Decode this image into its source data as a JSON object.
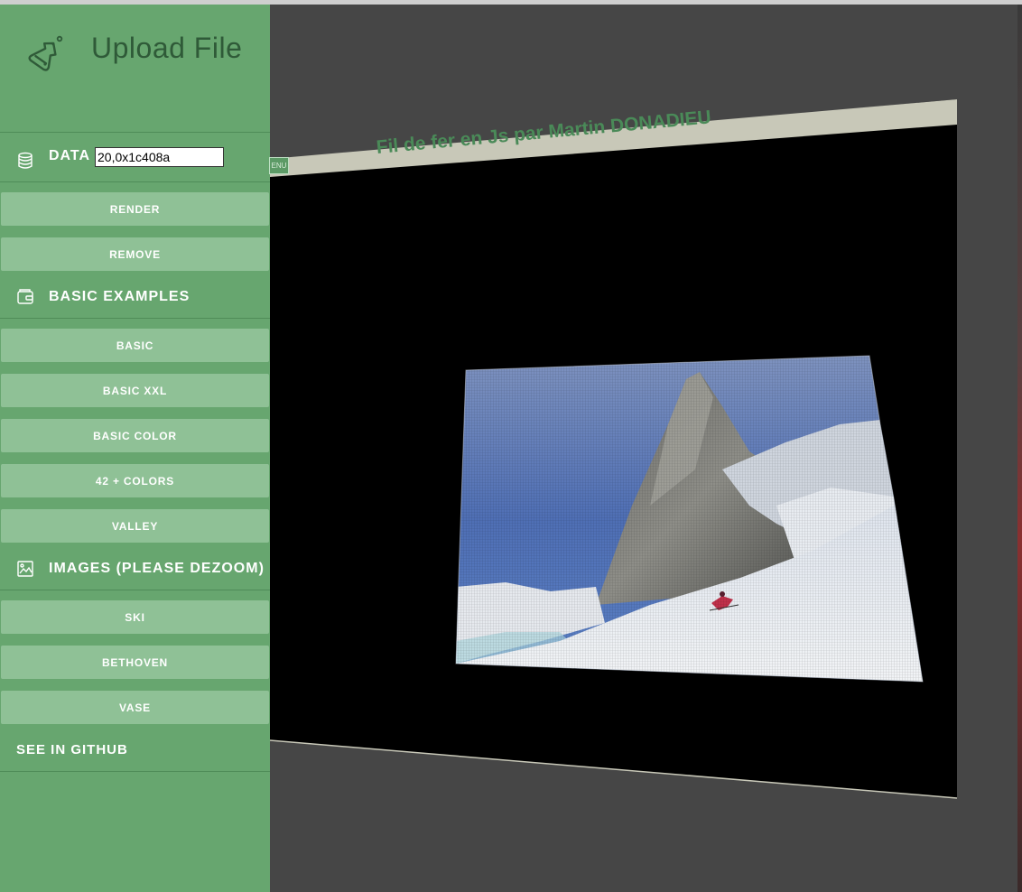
{
  "sidebar": {
    "app_title": "Upload File",
    "data_label": "DATA",
    "data_value": "20,0x1c408a",
    "render_label": "RENDER",
    "remove_label": "REMOVE",
    "basic_examples_label": "BASIC EXAMPLES",
    "basic_examples": [
      "BASIC",
      "BASIC XXL",
      "BASIC COLOR",
      "42 + COLORS",
      "VALLEY"
    ],
    "images_label": "IMAGES (PLEASE DEZOOM)",
    "images": [
      "SKI",
      "BETHOVEN",
      "VASE"
    ],
    "github_label": "SEE IN GITHUB"
  },
  "scene": {
    "banner_title": "Fil de fer en Js par Martin DONADIEU",
    "menu_label": "ENU"
  },
  "colors": {
    "sidebar_bg": "#67a66f",
    "button_bg": "#8fc196",
    "title_green": "#4a8a58",
    "viewport_bg": "#464646"
  }
}
